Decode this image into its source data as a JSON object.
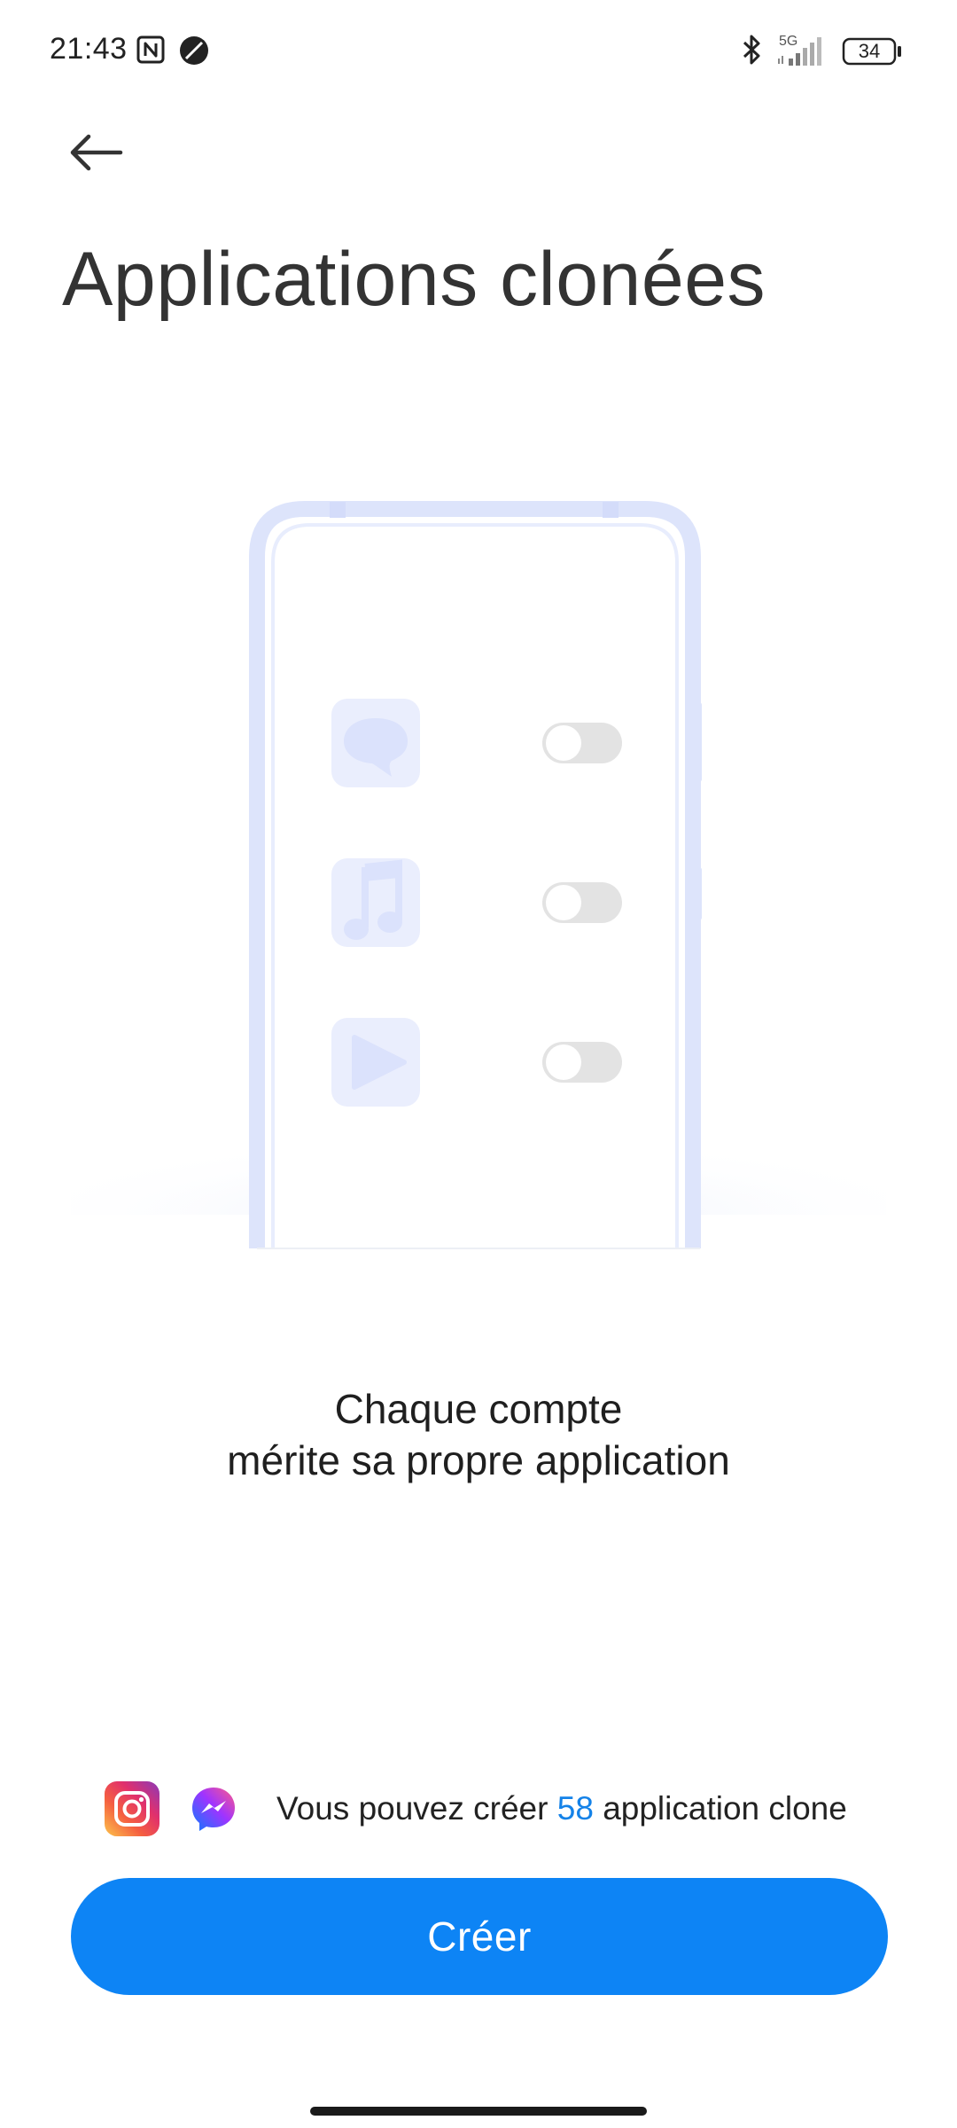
{
  "status_bar": {
    "time": "21:43",
    "network": "5G",
    "battery": "34"
  },
  "header": {
    "title": "Applications clonées"
  },
  "tagline": {
    "line1": "Chaque compte",
    "line2": "mérite sa propre application"
  },
  "info": {
    "prefix": "Vous pouvez créer",
    "count": "58",
    "suffix": "application clone",
    "apps": [
      "instagram-icon",
      "messenger-icon"
    ]
  },
  "actions": {
    "create_label": "Créer"
  },
  "colors": {
    "accent": "#0d84f5",
    "count_highlight": "#1482e8",
    "illustration_frame": "#dde4fb",
    "illustration_icon": "#e6ebfc"
  }
}
